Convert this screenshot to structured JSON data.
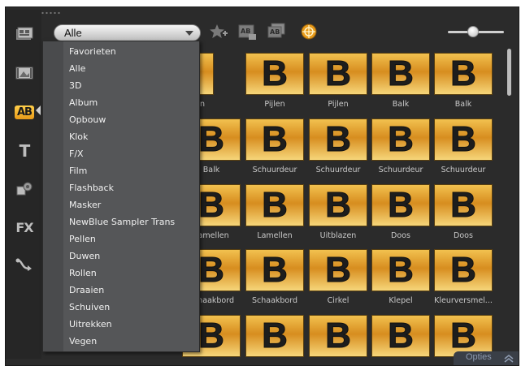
{
  "filter": {
    "selected": "Alle"
  },
  "sidebar": {
    "items": [
      {
        "icon": "instant-project-icon"
      },
      {
        "icon": "media-icon"
      },
      {
        "icon": "transition-icon",
        "label": "AB",
        "active": true
      },
      {
        "icon": "title-icon",
        "label": "T"
      },
      {
        "icon": "graphic-icon"
      },
      {
        "icon": "filter-icon",
        "label": "FX"
      },
      {
        "icon": "path-icon"
      }
    ]
  },
  "toolbar": {
    "buttons": [
      {
        "icon": "add-favorite-icon"
      },
      {
        "icon": "apply-transition-icon"
      },
      {
        "icon": "apply-transition-all-icon"
      },
      {
        "icon": "get-more-icon"
      }
    ]
  },
  "tile_letter": "B",
  "dropdown": {
    "items": [
      "Favorieten",
      "Alle",
      "3D",
      "Album",
      "Opbouw",
      "Klok",
      "F/X",
      "Film",
      "Flashback",
      "Masker",
      "NewBlue Sampler Trans",
      "Pellen",
      "Duwen",
      "Rollen",
      "Draaien",
      "Schuiven",
      "Uitrekken",
      "Vegen"
    ]
  },
  "grid": {
    "rows": [
      [
        "Accordeon",
        "Pijlen",
        "Pijlen",
        "Balk",
        "Balk"
      ],
      [
        "Balk",
        "Schuurdeur",
        "Schuurdeur",
        "Schuurdeur",
        "Schuurdeur"
      ],
      [
        "Lamellen",
        "Lamellen",
        "Uitblazen",
        "Doos",
        "Doos"
      ],
      [
        "Schaakbord",
        "Schaakbord",
        "Cirkel",
        "Klepel",
        "Kleurversmel..."
      ],
      [
        "",
        "",
        "",
        "",
        ""
      ]
    ]
  },
  "options": {
    "label": "Opties"
  },
  "colors": {
    "panel": "#2b2b2b",
    "accent": "#e89a18",
    "menu": "#555658"
  }
}
